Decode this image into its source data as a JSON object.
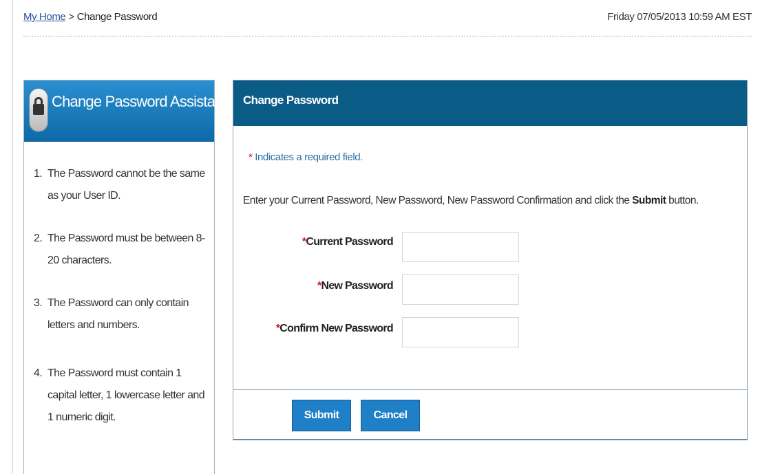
{
  "breadcrumb": {
    "home_link": "My Home",
    "separator": ">",
    "current": "Change Password"
  },
  "datetime": "Friday 07/05/2013 10:59 AM EST",
  "assistance": {
    "title": "Change Password Assistance",
    "items": [
      {
        "num": "1.",
        "text": "The Password cannot be the same as your User ID."
      },
      {
        "num": "2.",
        "text": "The Password must be between 8-20 characters."
      },
      {
        "num": "3.",
        "text": "The Password can only contain letters and numbers."
      },
      {
        "num": "4.",
        "text": "The Password must contain 1 capital letter, 1 lowercase letter and 1 numeric digit."
      }
    ]
  },
  "form": {
    "title": "Change Password",
    "required_star": "*",
    "required_note": "Indicates a required field.",
    "instructions_prefix": "Enter your Current Password, New Password, New Password Confirmation and click the",
    "instructions_bold": "Submit",
    "instructions_suffix": "button.",
    "fields": [
      {
        "label": "Current Password",
        "value": "",
        "placeholder": ""
      },
      {
        "label": "New Password",
        "value": "",
        "placeholder": ""
      },
      {
        "label": "Confirm New Password",
        "value": "",
        "placeholder": ""
      }
    ],
    "submit_label": "Submit",
    "cancel_label": "Cancel"
  },
  "colors": {
    "header_dark_blue": "#0b5b87",
    "assist_header_blue": "#1a7cbf",
    "button_blue": "#1f7fc7",
    "required_red": "#dd1111",
    "link_blue": "#2a4f9a"
  }
}
